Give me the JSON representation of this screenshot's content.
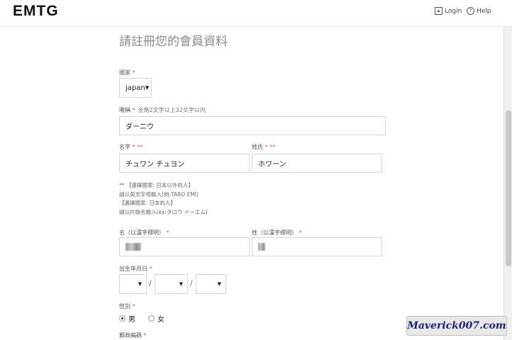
{
  "header": {
    "logo": "EMTG",
    "login_label": "Login",
    "help_label": "Help",
    "login_icon": "lock-icon",
    "help_icon": "question-circle-icon"
  },
  "form": {
    "title": "請註冊您的會員資料",
    "country": {
      "label": "國家",
      "required_mark": "*",
      "value": "japan"
    },
    "nickname": {
      "label": "暱稱",
      "required_mark": "*",
      "hint": "全角2文字以上32文字以内",
      "value": "ダーニウ"
    },
    "first_name": {
      "label": "名字",
      "required_mark": "* **",
      "value": "チュワン チュヨン"
    },
    "last_name": {
      "label": "姓氏",
      "required_mark": "* **",
      "value": "ホワーン"
    },
    "notes": [
      "** 【選擇國家: 日本以外的人】",
      "請以英文字母輸入(例:TARO EMI)",
      "【選擇國家: 日本的人】",
      "請以片假名輸入(ex:タロウ イーエム)"
    ],
    "first_name_kanji": {
      "label": "名（以漢字標明）",
      "required_mark": "*"
    },
    "last_name_kanji": {
      "label": "姓（以漢字標明）",
      "required_mark": "*"
    },
    "birthday": {
      "label": "出生年月日",
      "required_mark": "*",
      "separator": "/"
    },
    "gender": {
      "label": "性別",
      "required_mark": "*",
      "options": [
        "男",
        "女"
      ],
      "selected": "男"
    },
    "postal_code": {
      "label": "郵政編碼",
      "required_mark": "*"
    }
  },
  "watermark": "Maverick007.com"
}
